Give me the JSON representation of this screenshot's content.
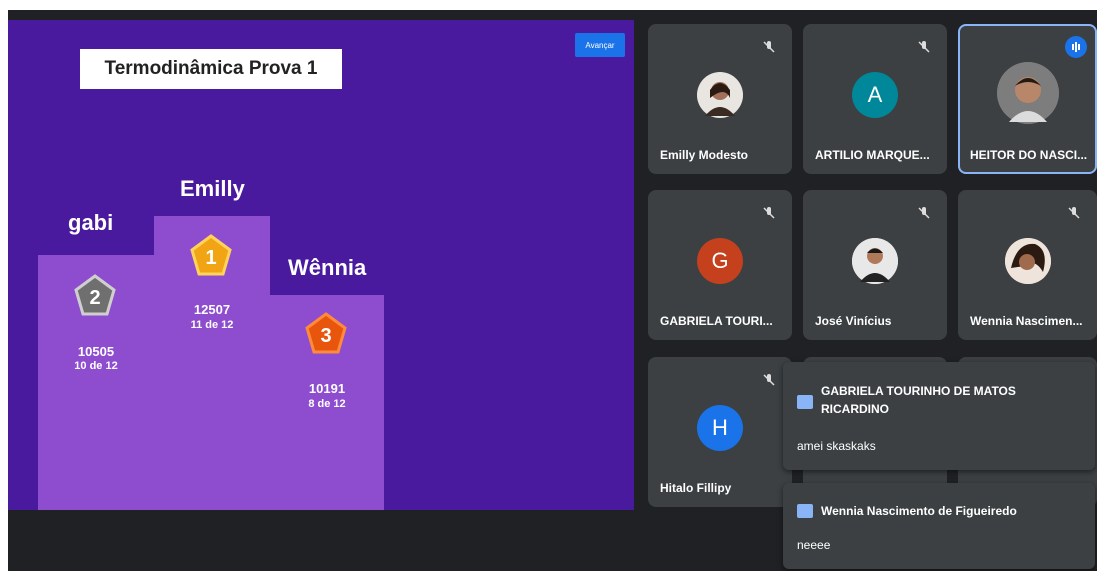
{
  "presentation": {
    "title": "Termodinâmica Prova 1",
    "advance_button": "Avançar",
    "podium": [
      {
        "place": "2",
        "name": "gabi",
        "score": "10505",
        "detail": "10 de 12",
        "badge_color": "#7a7a7a"
      },
      {
        "place": "1",
        "name": "Emilly",
        "score": "12507",
        "detail": "11 de 12",
        "badge_color": "#f2a514"
      },
      {
        "place": "3",
        "name": "Wênnia",
        "score": "10191",
        "detail": "8 de 12",
        "badge_color": "#e8560e"
      }
    ]
  },
  "participants": [
    {
      "name": "Emilly Modesto",
      "avatar_type": "photo",
      "muted": true
    },
    {
      "name": "ARTILIO MARQUE...",
      "avatar_type": "letter",
      "letter": "A",
      "avatar_color": "#00879a",
      "muted": true
    },
    {
      "name": "HEITOR DO NASCI...",
      "avatar_type": "photo",
      "speaking": true
    },
    {
      "name": "GABRIELA TOURI...",
      "avatar_type": "letter",
      "letter": "G",
      "avatar_color": "#c5401c",
      "muted": true
    },
    {
      "name": "José Vinícius",
      "avatar_type": "photo",
      "muted": true
    },
    {
      "name": "Wennia Nascimen...",
      "avatar_type": "photo",
      "muted": true
    },
    {
      "name": "Hitalo Fillipy",
      "avatar_type": "letter",
      "letter": "H",
      "avatar_color": "#1a73e8",
      "muted": true
    }
  ],
  "chat_notifications": [
    {
      "sender": "GABRIELA TOURINHO DE MATOS RICARDINO",
      "message": "amei skaskaks"
    },
    {
      "sender": "Wennia Nascimento de Figueiredo",
      "message": "neeee"
    }
  ]
}
